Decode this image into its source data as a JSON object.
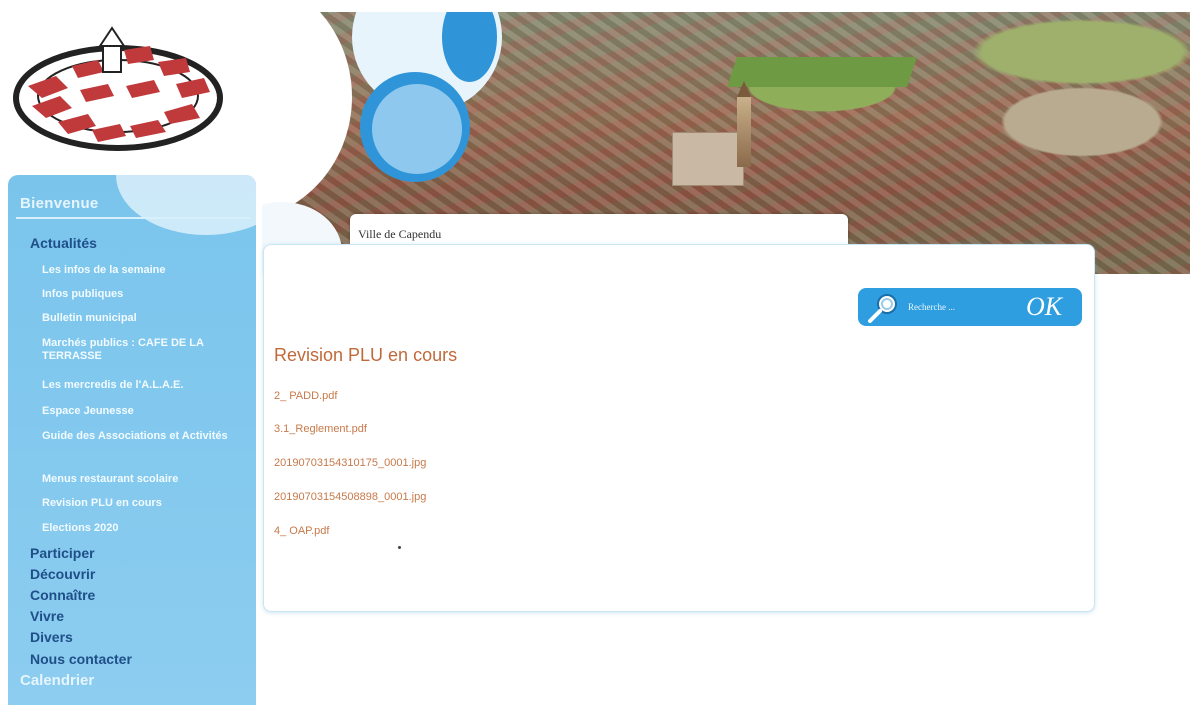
{
  "banner": {
    "tab_label": "Ville de Capendu"
  },
  "sidebar": {
    "header": "Bienvenue",
    "sections": [
      {
        "label": "Actualités",
        "items": [
          "Les infos de la semaine",
          "Infos publiques",
          "Bulletin municipal",
          "Marchés publics : CAFE DE LA TERRASSE",
          "Les mercredis de l'A.L.A.E.",
          "Espace Jeunesse",
          "Guide des Associations et Activités",
          "Menus restaurant scolaire",
          "Revision PLU en cours",
          "Elections 2020"
        ]
      },
      {
        "label": "Participer"
      },
      {
        "label": "Découvrir"
      },
      {
        "label": "Connaître"
      },
      {
        "label": "Vivre"
      },
      {
        "label": "Divers"
      },
      {
        "label": "Nous contacter"
      }
    ],
    "footer": "Calendrier"
  },
  "search": {
    "placeholder": "Recherche ...",
    "ok_label": "OK"
  },
  "main": {
    "title": "Revision PLU en cours",
    "documents": [
      "2_ PADD.pdf",
      "3.1_Reglement.pdf",
      "20190703154310175_0001.jpg",
      "20190703154508898_0001.jpg",
      "4_ OAP.pdf"
    ]
  },
  "colors": {
    "sidebar_bg": "#7ac4ec",
    "section_text": "#1f4f88",
    "accent_blue": "#2f9ee0",
    "link_orange": "#c77a4a"
  }
}
